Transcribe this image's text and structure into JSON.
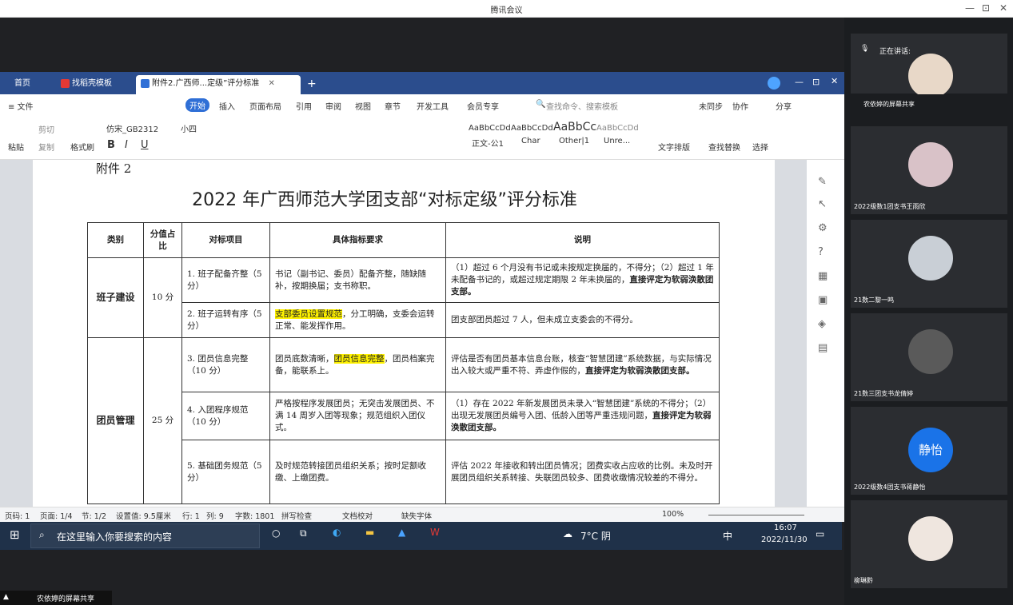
{
  "window": {
    "title": "腾讯会议",
    "min": "—",
    "max": "⊡",
    "close": "✕"
  },
  "wps": {
    "tabs": {
      "home": "首页",
      "template": "找稻壳模板",
      "doc": "附件2.广西师...定级”评分标准",
      "add": "+"
    },
    "menu": {
      "file": "≡ 文件",
      "start": "开始",
      "insert": "插入",
      "layout": "页面布局",
      "ref": "引用",
      "review": "审阅",
      "view": "视图",
      "chapter": "章节",
      "dev": "开发工具",
      "vip": "会员专享",
      "search": "查找命令、搜索模板",
      "sync": "未同步",
      "collab": "协作",
      "share": "分享"
    },
    "ribbon": {
      "paste": "粘贴",
      "cut": "剪切",
      "copy": "复制",
      "format": "格式刷",
      "font": "仿宋_GB2312",
      "size": "小四",
      "style1": "AaBbCcDd",
      "style1_name": "正文-公1",
      "style2": "AaBbCcDd",
      "style2_name": "Char",
      "style3": "AaBbCc",
      "style3_name": "Other|1",
      "style4": "AaBbCcDd",
      "style4_name": "Unre...",
      "textlayout": "文字排版",
      "findreplace": "查找替换",
      "select": "选择"
    },
    "status": {
      "page": "页码: 1",
      "pages": "页面: 1/4",
      "section": "节: 1/2",
      "setting": "设置值: 9.5厘米",
      "row": "行: 1",
      "col": "列: 9",
      "words": "字数: 1801",
      "spell": "拼写检查",
      "proof": "文档校对",
      "font_missing": "缺失字体",
      "zoom": "100%"
    }
  },
  "doc": {
    "attachment": "附件 2",
    "title": "2022 年广西师范大学团支部“对标定级”评分标准",
    "headers": [
      "类别",
      "分值占比",
      "对标项目",
      "具体指标要求",
      "说明"
    ],
    "groups": [
      {
        "category": "班子建设",
        "score": "10 分"
      },
      {
        "category": "团员管理",
        "score": "25 分"
      }
    ],
    "rows": [
      {
        "item": "1. 班子配备齐整（5 分）",
        "req_a": "书记（副书记、委员）配备齐整，随缺随补，按期换届；支书称职。",
        "req_hl": "",
        "req_b": "",
        "note": "（1）超过 6 个月没有书记或未按规定换届的，不得分；（2）超过 1 年未配备书记的，或超过规定期限 2 年未换届的，",
        "note_bold": "直接评定为软弱涣散团支部。"
      },
      {
        "item": "2. 班子运转有序（5 分）",
        "req_a": "",
        "req_hl": "支部委员设置规范",
        "req_b": "，分工明确，支委会运转正常、能发挥作用。",
        "note": "团支部团员超过 7 人，但未成立支委会的不得分。",
        "note_bold": ""
      },
      {
        "item": "3. 团员信息完整（10 分）",
        "req_a": "团员底数清晰，",
        "req_hl": "团员信息完整",
        "req_b": "，团员档案完备，能联系上。",
        "note": "评估是否有团员基本信息台账，核查“智慧团建”系统数据，与实际情况出入较大或严重不符、弄虚作假的，",
        "note_bold": "直接评定为软弱涣散团支部。"
      },
      {
        "item": "4. 入团程序规范（10 分）",
        "req_a": "严格按程序发展团员；无突击发展团员、不满 14 周岁入团等现象；规范组织入团仪式。",
        "req_hl": "",
        "req_b": "",
        "note": "（1）存在 2022 年新发展团员未录入“智慧团建”系统的不得分；（2）出现无发展团员编号入团、低龄入团等严重违规问题，",
        "note_bold": "直接评定为软弱涣散团支部。"
      },
      {
        "item": "5. 基础团务规范（5 分）",
        "req_a": "及时规范转接团员组织关系；按时足额收缴、上缴团费。",
        "req_hl": "",
        "req_b": "",
        "note": "评估 2022 年接收和转出团员情况；团费实收占应收的比例。未及时开展团员组织关系转接、失联团员较多、团费收缴情况较差的不得分。",
        "note_bold": ""
      }
    ]
  },
  "taskbar": {
    "search": "在这里输入你要搜索的内容",
    "weather": "7°C 阴",
    "ime": "中",
    "time": "16:07",
    "date": "2022/11/30"
  },
  "bottom_share": "农依婷的屏幕共享",
  "meeting": {
    "speaking_label": "正在讲话:",
    "participants": [
      {
        "name": "农依婷的屏幕共享"
      },
      {
        "name": "2022级数1团支书王雨欣"
      },
      {
        "name": "21数二黎一鸣"
      },
      {
        "name": "21数三团支书龙倩婷"
      },
      {
        "name": "2022级数4团支书蒋静怡",
        "initials": "静怡"
      },
      {
        "name": "柳琳黔"
      }
    ]
  },
  "colors": {
    "wps_tabbar": "#2b4d8d",
    "accent": "#1a73e8",
    "highlight": "#fff200"
  }
}
